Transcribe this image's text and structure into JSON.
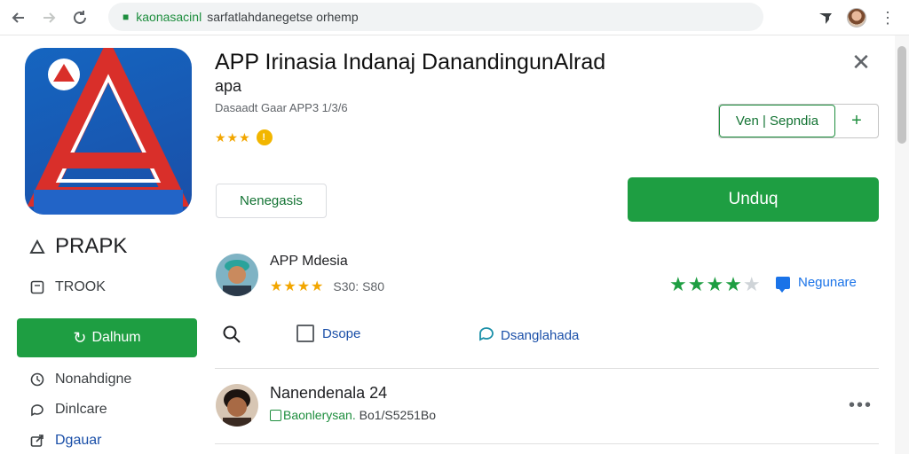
{
  "browser": {
    "url_highlight": "kaonasacinl",
    "url_rest": "sarfatlahdanegetse orhemp"
  },
  "app": {
    "title": "APP Irinasia Indanaj DanandingunAlrad",
    "subtitle": "apa",
    "developer": "Dasaadt Gaar APP3 1/3/6",
    "rating_stars": "★★★",
    "rating_badge": "!"
  },
  "buttons": {
    "outline_left": "Ven | Sepndia",
    "outline_right": "+",
    "secondary": "Nenegasis",
    "primary": "Unduq"
  },
  "sidebar": {
    "brand": "PRAPK",
    "items": [
      {
        "label": "TROOK",
        "icon": "square-icon"
      },
      {
        "label": "Nonahdigne",
        "icon": "history-icon"
      },
      {
        "label": "Dinlcare",
        "icon": "chat-icon"
      },
      {
        "label": "Dgauar",
        "icon": "share-icon"
      }
    ],
    "green_button": "Dalhum"
  },
  "reviews": [
    {
      "name": "APP Mdesia",
      "stars": "★★★★",
      "meta": "S30: S80"
    },
    {
      "name": "Nanendenala 24",
      "meta_green": "Baonlerysan.",
      "meta_rest": "Bo1/S5251Bo"
    }
  ],
  "right_rating": {
    "stars_on": "★★★★",
    "stars_off": "★",
    "link": "Negunare"
  },
  "actions": {
    "checkbox_label": "Dsope",
    "chat_label": "Dsanglahada"
  },
  "colors": {
    "accent_green": "#1e9e42",
    "link_blue": "#1a73e8",
    "star_gold": "#f2a600"
  }
}
